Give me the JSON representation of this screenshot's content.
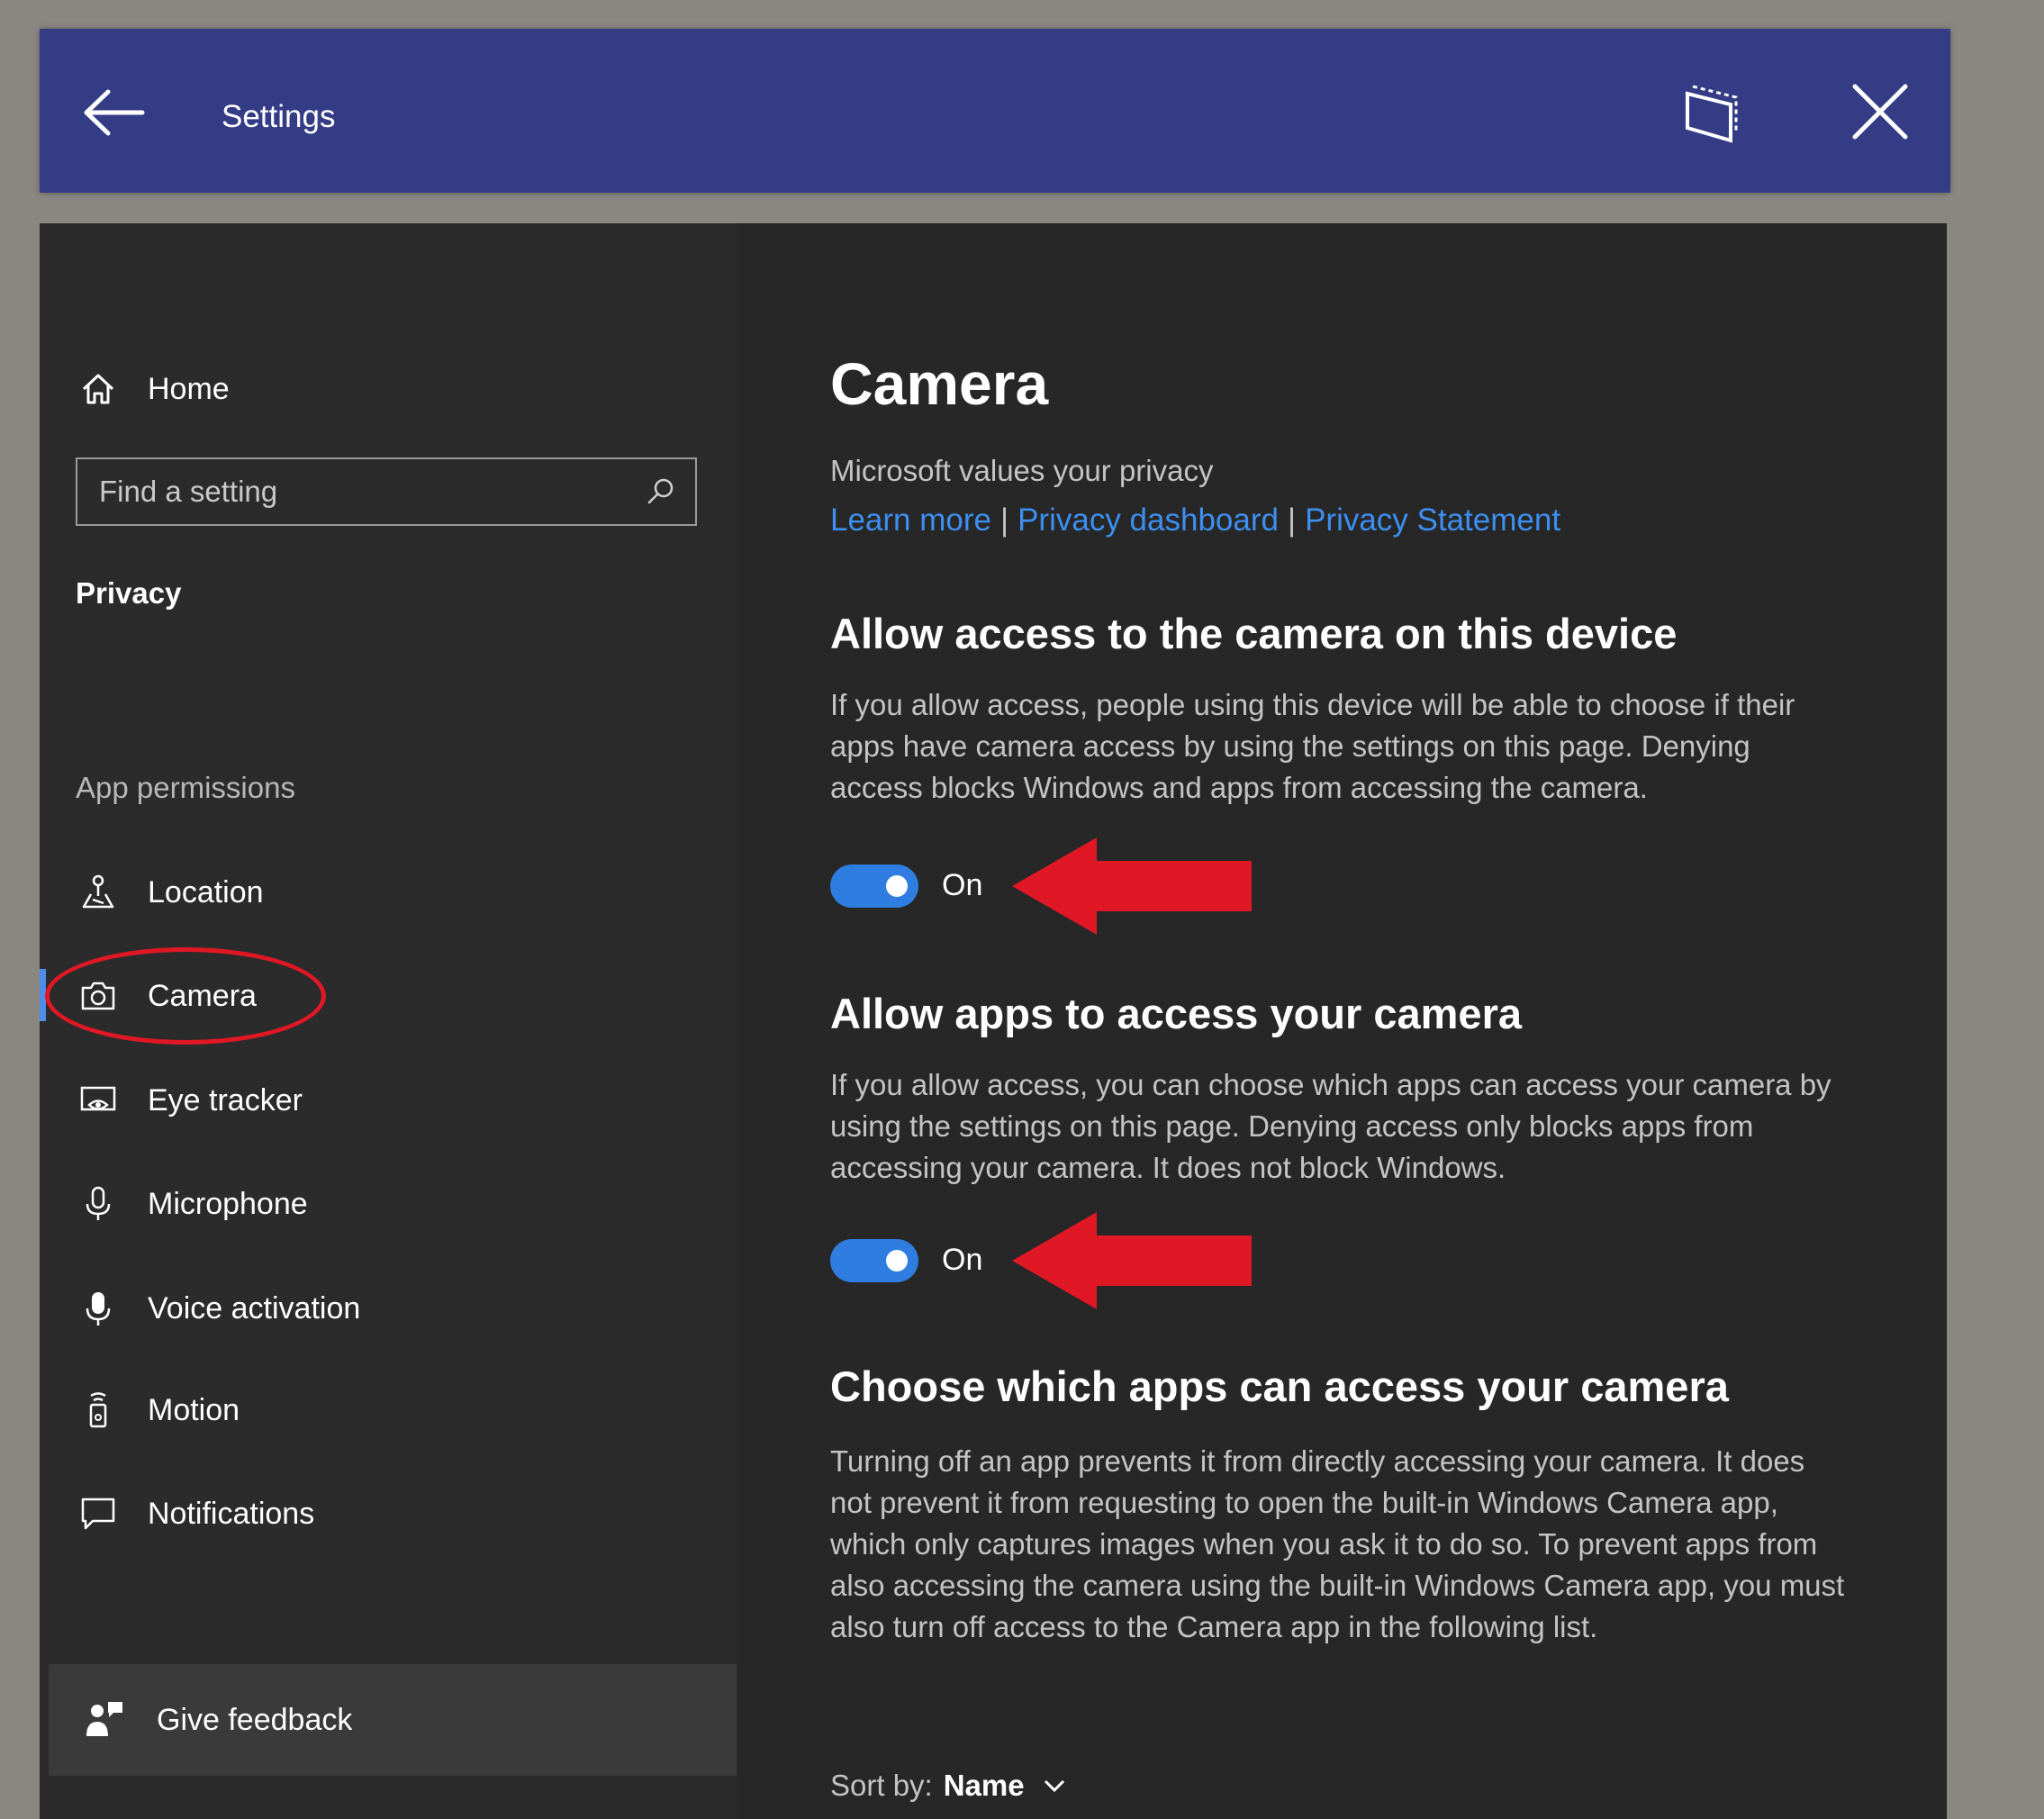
{
  "titlebar": {
    "title": "Settings",
    "back_icon": "arrow-left-icon",
    "snap_icon": "tablet-icon",
    "close_icon": "close-icon"
  },
  "sidebar": {
    "home": "Home",
    "search_placeholder": "Find a setting",
    "section_privacy": "Privacy",
    "section_app_permissions": "App permissions",
    "items": [
      {
        "label": "Location",
        "icon": "location-icon"
      },
      {
        "label": "Camera",
        "icon": "camera-icon",
        "selected": true
      },
      {
        "label": "Eye tracker",
        "icon": "eye-tracker-icon"
      },
      {
        "label": "Microphone",
        "icon": "microphone-icon"
      },
      {
        "label": "Voice activation",
        "icon": "voice-activation-icon"
      },
      {
        "label": "Motion",
        "icon": "motion-icon"
      },
      {
        "label": "Notifications",
        "icon": "notifications-icon"
      }
    ],
    "feedback": "Give feedback"
  },
  "content": {
    "title": "Camera",
    "privacy_text": "Microsoft values your privacy",
    "links": [
      "Learn more",
      "Privacy dashboard",
      "Privacy Statement"
    ],
    "link_separator": "|",
    "section1": {
      "heading": "Allow access to the camera on this device",
      "text": "If you allow access, people using this device will be able to choose if their apps have camera access by using the settings on this page. Denying access blocks Windows and apps from accessing the camera.",
      "toggle_label": "On"
    },
    "section2": {
      "heading": "Allow apps to access your camera",
      "text": "If you allow access, you can choose which apps can access your camera by using the settings on this page. Denying access only blocks apps from accessing your camera. It does not block Windows.",
      "toggle_label": "On"
    },
    "section3": {
      "heading": "Choose which apps can access your camera",
      "text": "Turning off an app prevents it from directly accessing your camera. It does not prevent it from requesting to open the built-in Windows Camera app, which only captures images when you ask it to do so. To prevent apps from also accessing the camera using the built-in Windows Camera app, you must also turn off access to the Camera app in the following list."
    },
    "sort_label": "Sort by:",
    "sort_value": "Name"
  },
  "colors": {
    "titlebar": "#343c86",
    "accent": "#2f7de0",
    "link": "#3d8ff0",
    "annotation": "#e01825"
  }
}
